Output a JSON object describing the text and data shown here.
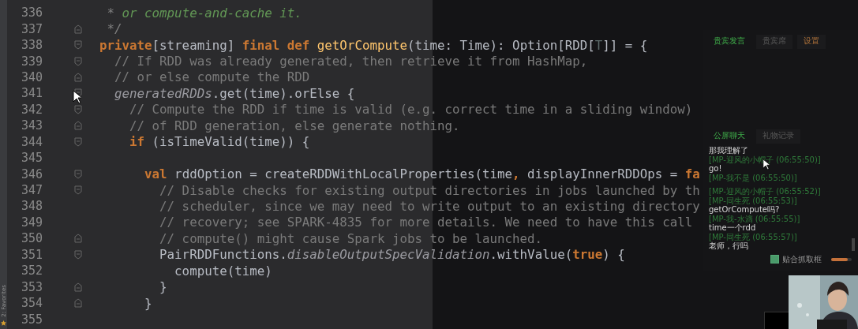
{
  "side_tool": {
    "label": "2: Favorites"
  },
  "lines": [
    {
      "number": "336",
      "kind": "plain",
      "tokens": [
        {
          "kind": "docmark",
          "text": " * "
        },
        {
          "kind": "doc",
          "text": "or compute-and-cache it."
        }
      ]
    },
    {
      "number": "337",
      "kind": "fold_end",
      "tokens": [
        {
          "kind": "docmark",
          "text": " */"
        }
      ]
    },
    {
      "number": "338",
      "kind": "fold_start",
      "tokens": [
        {
          "kind": "kw",
          "text": "private"
        },
        {
          "kind": "plain",
          "text": "[streaming] "
        },
        {
          "kind": "kw",
          "text": "final def"
        },
        {
          "kind": "fn",
          "text": " getOrCompute"
        },
        {
          "kind": "plain",
          "text": "(time: Time): Option[RDD["
        },
        {
          "kind": "tp",
          "text": "T"
        },
        {
          "kind": "plain",
          "text": "]] = {"
        }
      ]
    },
    {
      "number": "339",
      "kind": "fold_start",
      "tokens": [
        {
          "kind": "comment",
          "text": "  // If RDD was already generated, then retrieve it from HashMap,"
        }
      ]
    },
    {
      "number": "340",
      "kind": "fold_end",
      "tokens": [
        {
          "kind": "comment",
          "text": "  // or else compute the RDD"
        }
      ]
    },
    {
      "number": "341",
      "kind": "fold_start",
      "tokens": [
        {
          "kind": "italic",
          "text": "  generatedRDDs"
        },
        {
          "kind": "plain",
          "text": ".get(time).orElse {"
        }
      ]
    },
    {
      "number": "342",
      "kind": "fold_start",
      "tokens": [
        {
          "kind": "comment",
          "text": "    // Compute the RDD if time is valid (e.g. correct time in a sliding window)"
        }
      ]
    },
    {
      "number": "343",
      "kind": "fold_end",
      "tokens": [
        {
          "kind": "comment",
          "text": "    // of RDD generation, else generate nothing."
        }
      ]
    },
    {
      "number": "344",
      "kind": "fold_start",
      "tokens": [
        {
          "kind": "kw",
          "text": "    if"
        },
        {
          "kind": "plain",
          "text": " (isTimeValid(time)) {"
        }
      ]
    },
    {
      "number": "345",
      "kind": "plain"
    },
    {
      "number": "346",
      "kind": "fold_start",
      "tokens": [
        {
          "kind": "kw",
          "text": "      val"
        },
        {
          "kind": "plain",
          "text": " rddOption = createRDDWithLocalProperties(time"
        },
        {
          "kind": "kw",
          "text": ","
        },
        {
          "kind": "plain",
          "text": " displayInnerRDDOps = "
        },
        {
          "kind": "kw",
          "text": "fa"
        }
      ]
    },
    {
      "number": "347",
      "kind": "fold_start",
      "tokens": [
        {
          "kind": "comment",
          "text": "        // Disable checks for existing output directories in jobs launched by th"
        }
      ]
    },
    {
      "number": "348",
      "kind": "plain",
      "tokens": [
        {
          "kind": "comment",
          "text": "        // scheduler, since we may need to write output to an existing directory"
        }
      ]
    },
    {
      "number": "349",
      "kind": "plain",
      "tokens": [
        {
          "kind": "comment",
          "text": "        // recovery; see SPARK-4835 for more details. We need to have this call"
        }
      ]
    },
    {
      "number": "350",
      "kind": "fold_end",
      "tokens": [
        {
          "kind": "comment",
          "text": "        // compute() might cause Spark jobs to be launched."
        }
      ]
    },
    {
      "number": "351",
      "kind": "fold_start",
      "tokens": [
        {
          "kind": "plain",
          "text": "        PairRDDFunctions."
        },
        {
          "kind": "italic",
          "text": "disableOutputSpecValidation"
        },
        {
          "kind": "plain",
          "text": ".withValue("
        },
        {
          "kind": "kw",
          "text": "true"
        },
        {
          "kind": "plain",
          "text": ") {"
        }
      ]
    },
    {
      "number": "352",
      "kind": "plain",
      "tokens": [
        {
          "kind": "plain",
          "text": "          compute(time)"
        }
      ]
    },
    {
      "number": "353",
      "kind": "fold_end",
      "tokens": [
        {
          "kind": "plain",
          "text": "        }"
        }
      ]
    },
    {
      "number": "354",
      "kind": "fold_end",
      "tokens": [
        {
          "kind": "plain",
          "text": "      }"
        }
      ]
    },
    {
      "number": "355",
      "kind": "plain"
    }
  ],
  "chat_panel": {
    "top_tabs": [
      {
        "label": "贵宾发言",
        "selected": true,
        "kind": "tab"
      },
      {
        "label": "贵宾席",
        "selected": false,
        "kind": "tab"
      },
      {
        "label": "设置",
        "selected": false,
        "kind": "setting"
      }
    ],
    "bottom_tabs": [
      {
        "label": "公屏聊天",
        "selected": true
      },
      {
        "label": "礼物记录",
        "selected": false
      }
    ],
    "messages": [
      {
        "kind": "text",
        "text": "那我理解了"
      },
      {
        "kind": "user",
        "text": "[MP-迎风的小帽子 (06:55:50)]"
      },
      {
        "kind": "text",
        "text": "go!"
      },
      {
        "kind": "user",
        "text": "[MP-我不是 (06:55:50)]"
      },
      {
        "kind": "gap"
      },
      {
        "kind": "user",
        "text": "[MP-迎风的小帽子 (06:55:52)]"
      },
      {
        "kind": "user",
        "text": "[MP-同生死 (06:55:53)]"
      },
      {
        "kind": "text",
        "text": "getOrCompute吗?"
      },
      {
        "kind": "user",
        "text": "[MP-我-水滴 (06:55:55)]"
      },
      {
        "kind": "text",
        "text": "time一个rdd"
      },
      {
        "kind": "user",
        "text": "[MP-同生死 (06:55:57)]"
      },
      {
        "kind": "text",
        "text": "老师，行吗"
      }
    ],
    "snap_option": {
      "label": "贴合抓取框",
      "checked": true
    },
    "opacity_slider": {
      "level": 0.8
    }
  }
}
